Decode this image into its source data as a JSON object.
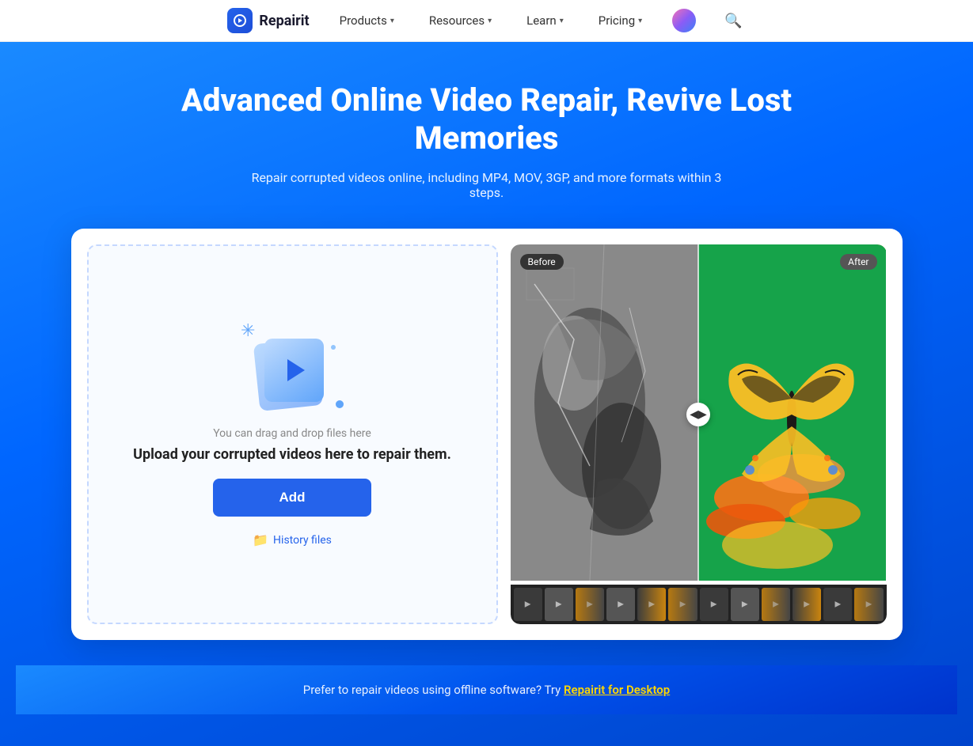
{
  "navbar": {
    "logo_text": "Repairit",
    "products_label": "Products",
    "resources_label": "Resources",
    "learn_label": "Learn",
    "pricing_label": "Pricing"
  },
  "hero": {
    "title": "Advanced Online Video Repair, Revive Lost Memories",
    "subtitle": "Repair corrupted videos online, including MP4, MOV, 3GP, and more formats within 3 steps."
  },
  "upload": {
    "drag_text": "You can drag and drop files here",
    "main_text": "Upload your corrupted videos here to repair them.",
    "add_button_label": "Add",
    "history_label": "History files"
  },
  "preview": {
    "before_label": "Before",
    "after_label": "After"
  },
  "footer": {
    "text": "Prefer to repair videos using offline software? Try ",
    "link_text": "Repairit for Desktop"
  }
}
